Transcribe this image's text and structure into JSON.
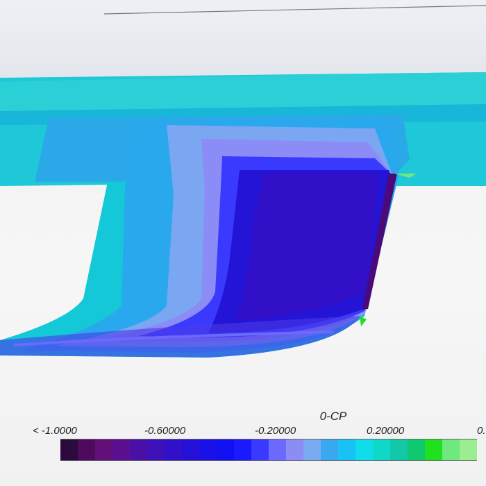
{
  "legend": {
    "title": "0-CP",
    "tick_labels": [
      "< -1.0000",
      "-0.60000",
      "-0.20000",
      "0.20000",
      "0."
    ],
    "colors": [
      "#2b0a3d",
      "#4d0a5e",
      "#64107a",
      "#5a1090",
      "#4a10a6",
      "#3d10b8",
      "#3010c8",
      "#2510d8",
      "#1a10e8",
      "#1010f0",
      "#1a1aff",
      "#3a3aff",
      "#6a6aff",
      "#8c8cf5",
      "#7aaaf2",
      "#3aa8f0",
      "#18c2f2",
      "#10dcec",
      "#10d8c8",
      "#12c8a8",
      "#10c870",
      "#20e020",
      "#70e880",
      "#9aee90",
      "#c4f080",
      "#e8f030",
      "#fff000",
      "#ffd000"
    ],
    "range": [
      -1.0,
      0.4
    ]
  }
}
